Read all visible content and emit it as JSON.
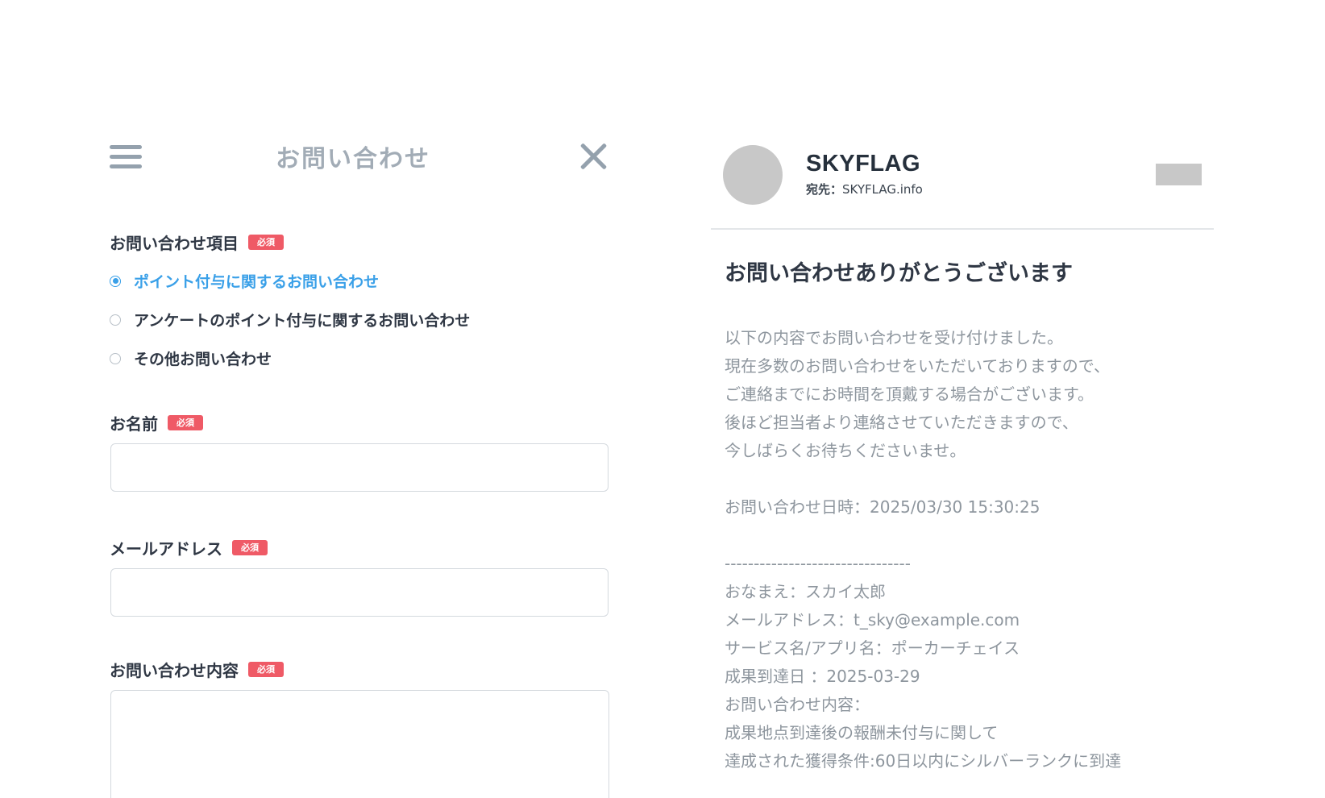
{
  "form": {
    "title": "お問い合わせ",
    "required_label": "必須",
    "inquiry_type": {
      "label": "お問い合わせ項目",
      "options": [
        {
          "label": "ポイント付与に関するお問い合わせ",
          "selected": true
        },
        {
          "label": "アンケートのポイント付与に関するお問い合わせ",
          "selected": false
        },
        {
          "label": "その他お問い合わせ",
          "selected": false
        }
      ]
    },
    "name": {
      "label": "お名前",
      "value": "",
      "placeholder": ""
    },
    "email": {
      "label": "メールアドレス",
      "value": "",
      "placeholder": ""
    },
    "message": {
      "label": "お問い合わせ内容",
      "value": "",
      "placeholder": ""
    }
  },
  "mail": {
    "sender": "SKYFLAG",
    "recipient_label": "宛先：",
    "recipient": "SKYFLAG.info",
    "subject": "お問い合わせありがとうございます",
    "body_lines": [
      "以下の内容でお問い合わせを受け付けました。",
      "現在多数のお問い合わせをいただいておりますので、",
      "ご連絡までにお時間を頂戴する場合がございます。",
      "後ほど担当者より連絡させていただきますので、",
      "今しばらくお待ちくださいませ。",
      "",
      "お問い合わせ日時：2025/03/30 15:30:25",
      "",
      "--------------------------------",
      "おなまえ：スカイ太郎",
      "メールアドレス：t_sky@example.com",
      "サービス名/アプリ名：ポーカーチェイス",
      "成果到達日 ：2025-03-29",
      "お問い合わせ内容：",
      "成果地点到達後の報酬未付与に関して",
      "達成された獲得条件:60日以内にシルバーランクに到達"
    ]
  },
  "colors": {
    "accent": "#3aa0e8",
    "required_badge": "#ef5a66",
    "icon_gray": "#94a1ad",
    "body_text_gray": "#8e969e",
    "placeholder_gray": "#c8c8c8"
  },
  "icons": {
    "menu": "hamburger-menu-icon",
    "close": "close-x-icon"
  }
}
